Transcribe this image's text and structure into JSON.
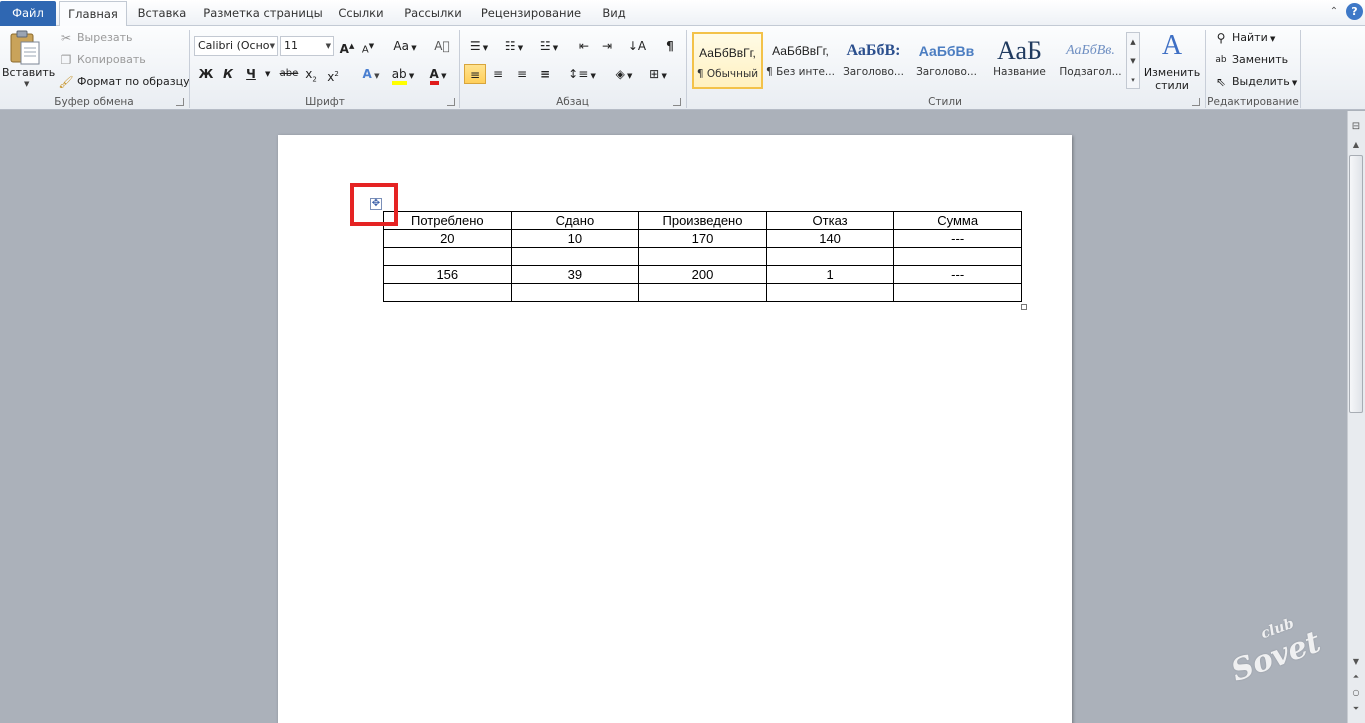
{
  "tabs": {
    "file": "Файл",
    "items": [
      "Главная",
      "Вставка",
      "Разметка страницы",
      "Ссылки",
      "Рассылки",
      "Рецензирование",
      "Вид"
    ]
  },
  "clipboard": {
    "paste": "Вставить",
    "cut": "Вырезать",
    "copy": "Копировать",
    "format_painter": "Формат по образцу",
    "group": "Буфер обмена"
  },
  "font": {
    "name": "Calibri (Осно",
    "size": "11",
    "group": "Шрифт",
    "bold": "Ж",
    "italic": "К",
    "underline": "Ч",
    "strike": "abe",
    "case": "Аа"
  },
  "paragraph": {
    "group": "Абзац",
    "pilcrow": "¶"
  },
  "styles": {
    "group": "Стили",
    "change": "Изменить стили",
    "items": [
      {
        "sample": "АаБбВвГг,",
        "name": "¶ Обычный"
      },
      {
        "sample": "АаБбВвГг,",
        "name": "¶ Без инте..."
      },
      {
        "sample": "АаБбВ:",
        "name": "Заголово..."
      },
      {
        "sample": "АаБбВв",
        "name": "Заголово..."
      },
      {
        "sample": "АаБ",
        "name": "Название"
      },
      {
        "sample": "АаБбВв.",
        "name": "Подзагол..."
      }
    ]
  },
  "editing": {
    "group": "Редактирование",
    "find": "Найти",
    "replace": "Заменить",
    "select": "Выделить"
  },
  "table": {
    "headers": [
      "Потреблено",
      "Сдано",
      "Произведено",
      "Отказ",
      "Сумма"
    ],
    "rows": [
      [
        "20",
        "10",
        "170",
        "140",
        "---"
      ],
      [
        "",
        "",
        "",
        "",
        ""
      ],
      [
        "156",
        "39",
        "200",
        "1",
        "---"
      ],
      [
        "",
        "",
        "",
        "",
        ""
      ]
    ]
  },
  "watermark": {
    "line1": "club",
    "line2": "Sovet"
  },
  "colors": {
    "file_tab": "#2f67b2",
    "highlight": "#e52323",
    "selected_style": "#f3c24a"
  }
}
